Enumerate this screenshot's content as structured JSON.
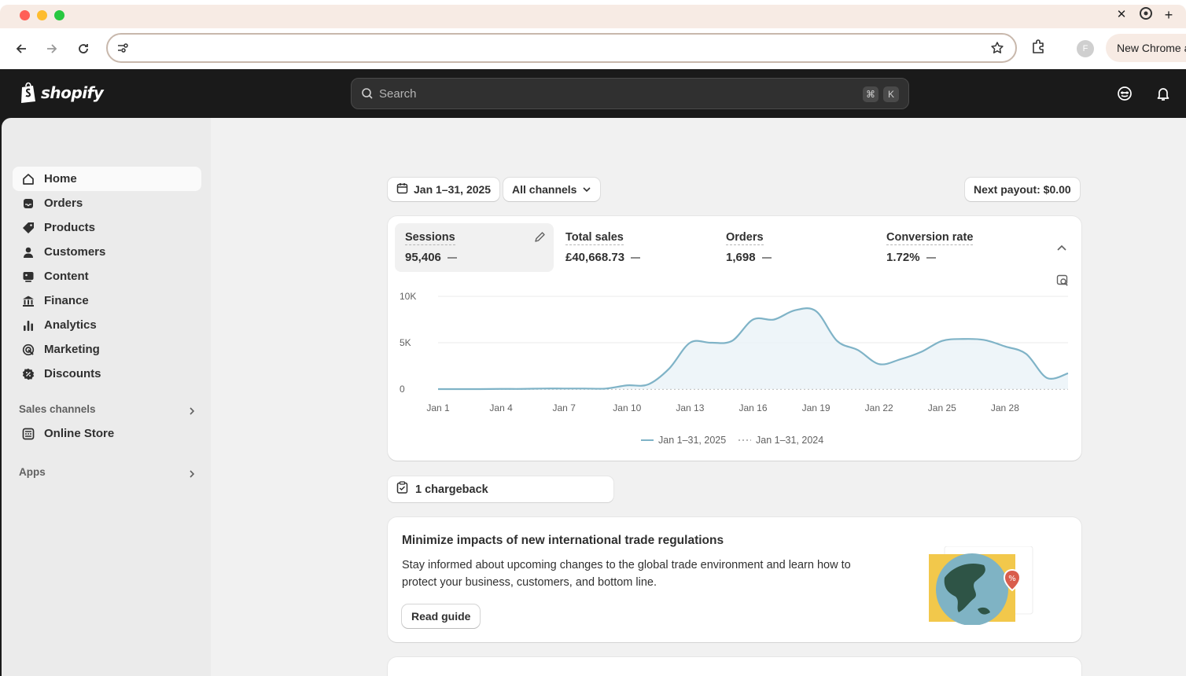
{
  "browser": {
    "new_tab_label": "+",
    "close_label": "✕",
    "profile_initial": "F",
    "new_chrome_label": "New Chrome a"
  },
  "header": {
    "logo_text": "shopify",
    "search_placeholder": "Search",
    "shortcut_cmd": "⌘",
    "shortcut_key": "K"
  },
  "sidebar": {
    "items": [
      {
        "label": "Home",
        "icon": "home-icon"
      },
      {
        "label": "Orders",
        "icon": "inbox-icon"
      },
      {
        "label": "Products",
        "icon": "tag-icon"
      },
      {
        "label": "Customers",
        "icon": "person-icon"
      },
      {
        "label": "Content",
        "icon": "image-icon"
      },
      {
        "label": "Finance",
        "icon": "bank-icon"
      },
      {
        "label": "Analytics",
        "icon": "bar-chart-icon"
      },
      {
        "label": "Marketing",
        "icon": "target-icon"
      },
      {
        "label": "Discounts",
        "icon": "discount-icon"
      }
    ],
    "sales_channels_label": "Sales channels",
    "online_store_label": "Online Store",
    "apps_label": "Apps"
  },
  "filters": {
    "date_range": "Jan 1–31, 2025",
    "channels": "All channels",
    "payout": "Next payout: $0.00"
  },
  "metrics": [
    {
      "label": "Sessions",
      "value": "95,406"
    },
    {
      "label": "Total sales",
      "value": "£40,668.73"
    },
    {
      "label": "Orders",
      "value": "1,698"
    },
    {
      "label": "Conversion rate",
      "value": "1.72%"
    }
  ],
  "chart_data": {
    "type": "line",
    "x": [
      "Jan 1",
      "Jan 2",
      "Jan 3",
      "Jan 4",
      "Jan 5",
      "Jan 6",
      "Jan 7",
      "Jan 8",
      "Jan 9",
      "Jan 10",
      "Jan 11",
      "Jan 12",
      "Jan 13",
      "Jan 14",
      "Jan 15",
      "Jan 16",
      "Jan 17",
      "Jan 18",
      "Jan 19",
      "Jan 20",
      "Jan 21",
      "Jan 22",
      "Jan 23",
      "Jan 24",
      "Jan 25",
      "Jan 26",
      "Jan 27",
      "Jan 28",
      "Jan 29",
      "Jan 30",
      "Jan 31"
    ],
    "x_tick_labels": [
      "Jan 1",
      "Jan 4",
      "Jan 7",
      "Jan 10",
      "Jan 13",
      "Jan 16",
      "Jan 19",
      "Jan 22",
      "Jan 25",
      "Jan 28"
    ],
    "y_tick_labels": [
      "10K",
      "5K",
      "0"
    ],
    "ylim": [
      0,
      10000
    ],
    "series": [
      {
        "name": "Jan 1–31, 2025",
        "color": "#7fb3c7",
        "style": "solid",
        "values": [
          0,
          0,
          0,
          20,
          20,
          60,
          60,
          60,
          60,
          400,
          500,
          2200,
          5000,
          5000,
          5200,
          7500,
          7500,
          8500,
          8400,
          5200,
          4200,
          2700,
          3200,
          4000,
          5200,
          5400,
          5300,
          4600,
          3800,
          1200,
          1700
        ]
      },
      {
        "name": "Jan 1–31, 2024",
        "color": "#b5b5b5",
        "style": "dotted",
        "values": [
          0,
          0,
          0,
          0,
          0,
          0,
          0,
          0,
          0,
          0,
          0,
          0,
          0,
          0,
          0,
          0,
          0,
          0,
          0,
          0,
          0,
          0,
          0,
          0,
          0,
          0,
          0,
          0,
          0,
          0,
          0
        ]
      }
    ],
    "grid": true,
    "legend": "bottom-center"
  },
  "chargeback": {
    "label": "1 chargeback"
  },
  "promo": {
    "title": "Minimize impacts of new international trade regulations",
    "body": "Stay informed about upcoming changes to the global trade environment and learn how to protect your business, customers, and bottom line.",
    "button": "Read guide"
  }
}
